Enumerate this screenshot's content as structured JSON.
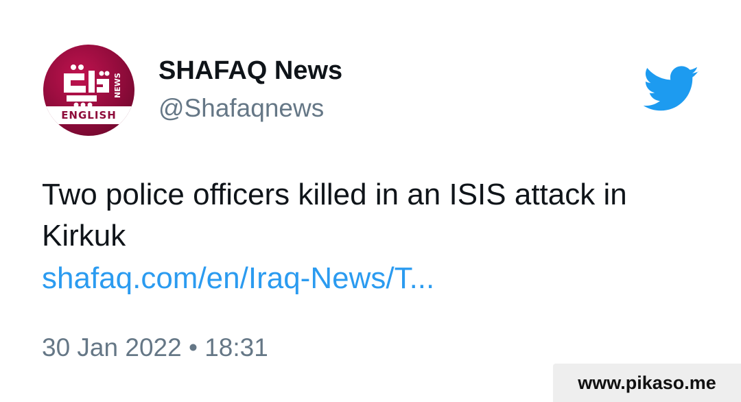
{
  "tweet": {
    "author": {
      "display_name": "SHAFAQ News",
      "handle": "@Shafaqnews",
      "avatar": {
        "icon": "shafaq-news-logo",
        "label": "ENGLISH",
        "brand_color": "#8e0b3a"
      }
    },
    "platform_icon": "twitter-bird-icon",
    "platform_color": "#1d9bf0",
    "text": "Two police officers killed in an ISIS attack in Kirkuk",
    "link": "shafaq.com/en/Iraq-News/T...",
    "timestamp": "30 Jan 2022 • 18:31"
  },
  "watermark": {
    "text": "www.pikaso.me"
  }
}
